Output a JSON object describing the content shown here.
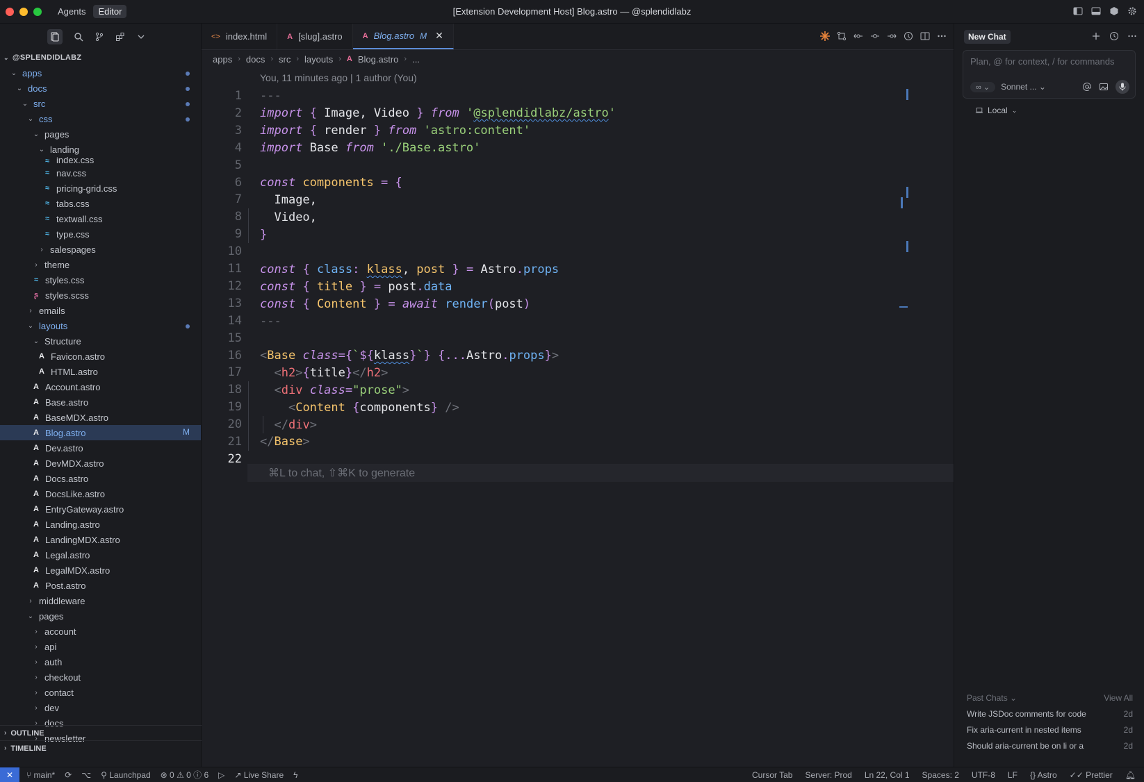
{
  "titlebar": {
    "title": "[Extension Development Host] Blog.astro — @splendidlabz",
    "modes": [
      "Agents",
      "Editor"
    ],
    "traffic_colors": [
      "#ff5f57",
      "#febc2e",
      "#28c840"
    ]
  },
  "sidebar": {
    "root": "@SPLENDIDLABZ",
    "items": [
      {
        "label": "apps",
        "chev": "v",
        "depth": 0,
        "blue": true,
        "dot": true
      },
      {
        "label": "docs",
        "chev": "v",
        "depth": 1,
        "blue": true,
        "dot": true
      },
      {
        "label": "src",
        "chev": "v",
        "depth": 2,
        "blue": true,
        "dot": true
      },
      {
        "label": "css",
        "chev": "v",
        "depth": 3,
        "blue": true,
        "dot": true
      },
      {
        "label": "pages",
        "chev": "v",
        "depth": 4
      },
      {
        "label": "landing",
        "chev": "v",
        "depth": 5
      },
      {
        "label": "index.css",
        "icon": "css",
        "depth": 6
      },
      {
        "label": "nav.css",
        "icon": "css",
        "depth": 6
      },
      {
        "label": "pricing-grid.css",
        "icon": "css",
        "depth": 6
      },
      {
        "label": "tabs.css",
        "icon": "css",
        "depth": 6
      },
      {
        "label": "textwall.css",
        "icon": "css",
        "depth": 6
      },
      {
        "label": "type.css",
        "icon": "css",
        "depth": 6
      },
      {
        "label": "salespages",
        "chev": ">",
        "depth": 5
      },
      {
        "label": "theme",
        "chev": ">",
        "depth": 4
      },
      {
        "label": "styles.css",
        "icon": "css",
        "depth": 4
      },
      {
        "label": "styles.scss",
        "icon": "scss",
        "depth": 4
      },
      {
        "label": "emails",
        "chev": ">",
        "depth": 3
      },
      {
        "label": "layouts",
        "chev": "v",
        "depth": 3,
        "blue": true,
        "dot": true
      },
      {
        "label": "Structure",
        "chev": "v",
        "depth": 4
      },
      {
        "label": "Favicon.astro",
        "icon": "astro",
        "depth": 5
      },
      {
        "label": "HTML.astro",
        "icon": "astro",
        "depth": 5
      },
      {
        "label": "Account.astro",
        "icon": "astro",
        "depth": 4
      },
      {
        "label": "Base.astro",
        "icon": "astro",
        "depth": 4
      },
      {
        "label": "BaseMDX.astro",
        "icon": "astro",
        "depth": 4
      },
      {
        "label": "Blog.astro",
        "icon": "astro",
        "depth": 4,
        "blue": true,
        "selected": true,
        "badge": "M"
      },
      {
        "label": "Dev.astro",
        "icon": "astro",
        "depth": 4
      },
      {
        "label": "DevMDX.astro",
        "icon": "astro",
        "depth": 4
      },
      {
        "label": "Docs.astro",
        "icon": "astro",
        "depth": 4
      },
      {
        "label": "DocsLike.astro",
        "icon": "astro",
        "depth": 4
      },
      {
        "label": "EntryGateway.astro",
        "icon": "astro",
        "depth": 4
      },
      {
        "label": "Landing.astro",
        "icon": "astro",
        "depth": 4
      },
      {
        "label": "LandingMDX.astro",
        "icon": "astro",
        "depth": 4
      },
      {
        "label": "Legal.astro",
        "icon": "astro",
        "depth": 4
      },
      {
        "label": "LegalMDX.astro",
        "icon": "astro",
        "depth": 4
      },
      {
        "label": "Post.astro",
        "icon": "astro",
        "depth": 4
      },
      {
        "label": "middleware",
        "chev": ">",
        "depth": 3
      },
      {
        "label": "pages",
        "chev": "v",
        "depth": 3
      },
      {
        "label": "account",
        "chev": ">",
        "depth": 4
      },
      {
        "label": "api",
        "chev": ">",
        "depth": 4
      },
      {
        "label": "auth",
        "chev": ">",
        "depth": 4
      },
      {
        "label": "checkout",
        "chev": ">",
        "depth": 4
      },
      {
        "label": "contact",
        "chev": ">",
        "depth": 4
      },
      {
        "label": "dev",
        "chev": ">",
        "depth": 4
      },
      {
        "label": "docs",
        "chev": ">",
        "depth": 4
      },
      {
        "label": "newsletter",
        "chev": ">",
        "depth": 4
      }
    ],
    "outline": "OUTLINE",
    "timeline": "TIMELINE"
  },
  "editor": {
    "tabs": [
      {
        "label": "index.html",
        "icon": "<>"
      },
      {
        "label": "[slug].astro",
        "icon": "A"
      },
      {
        "label": "Blog.astro",
        "icon": "A",
        "active": true,
        "badge": "M"
      }
    ],
    "breadcrumb": [
      "apps",
      "docs",
      "src",
      "layouts",
      "Blog.astro",
      "..."
    ],
    "blame": "You, 11 minutes ago | 1 author (You)",
    "line_numbers": [
      "1",
      "2",
      "3",
      "4",
      "5",
      "6",
      "7",
      "8",
      "9",
      "10",
      "11",
      "12",
      "13",
      "14",
      "15",
      "16",
      "17",
      "18",
      "19",
      "20",
      "21",
      "22"
    ],
    "ghost_hint": "⌘L to chat, ⇧⌘K to generate",
    "code": {
      "l1": "---",
      "import": "import",
      "from": "from",
      "const": "const",
      "await": "await",
      "img": "Image",
      "vid": "Video",
      "mod1": "@splendidlabz/astro",
      "render": "render",
      "mod2": "'astro:content'",
      "base_id": "Base",
      "mod3": "'./Base.astro'",
      "components": "components",
      "class_key": "class",
      "klass": "klass",
      "post": "post",
      "astro": "Astro",
      "props": "props",
      "title": "title",
      "data": "data",
      "content": "Content",
      "h2": "h2",
      "div": "div",
      "prose": "\"prose\""
    }
  },
  "chat": {
    "tab": "New Chat",
    "placeholder": "Plan, @ for context, / for commands",
    "mode_pill": "∞ ⌄",
    "model": "Sonnet ...",
    "local": "Local",
    "past_label": "Past Chats",
    "view_all": "View All",
    "past": [
      {
        "title": "Write JSDoc comments for code",
        "age": "2d"
      },
      {
        "title": "Fix aria-current in nested items",
        "age": "2d"
      },
      {
        "title": "Should aria-current be on li or a",
        "age": "2d"
      }
    ]
  },
  "statusbar": {
    "branch": "main*",
    "launchpad": "Launchpad",
    "problems": "⊗ 0 ⚠ 0 ⓘ 6",
    "liveshare": "Live Share",
    "right": [
      "Cursor Tab",
      "Server: Prod",
      "Ln 22, Col 1",
      "Spaces: 2",
      "UTF-8",
      "LF",
      "{} Astro",
      "✓✓ Prettier"
    ]
  }
}
